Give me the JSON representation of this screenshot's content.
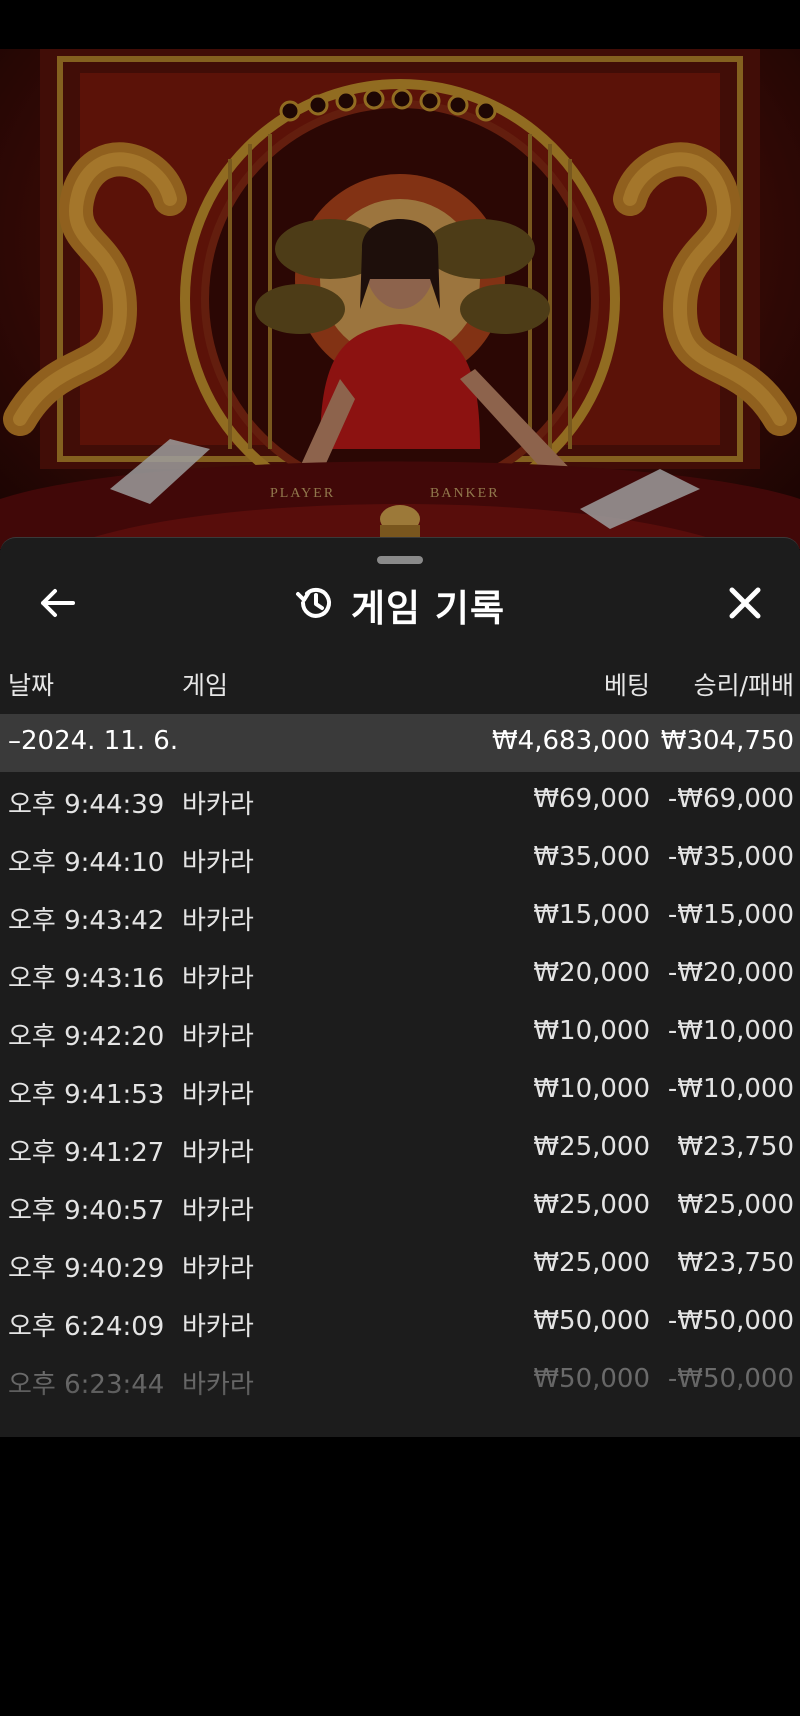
{
  "video": {
    "table_labels": [
      "PLAYER",
      "BANKER"
    ]
  },
  "sheet": {
    "title": "게임 기록",
    "icons": {
      "back": "arrow-left-icon",
      "history": "history-clock-icon",
      "close": "close-icon"
    },
    "columns": {
      "date": "날짜",
      "game": "게임",
      "bet": "베팅",
      "win_loss": "승리/패배"
    },
    "group": {
      "date": "–2024. 11. 6.",
      "total_bet": "₩4,683,000",
      "total_win_loss": "₩304,750"
    },
    "rows": [
      {
        "time": "오후 9:44:39",
        "game": "바카라",
        "bet": "₩69,000",
        "result": "-₩69,000"
      },
      {
        "time": "오후 9:44:10",
        "game": "바카라",
        "bet": "₩35,000",
        "result": "-₩35,000"
      },
      {
        "time": "오후 9:43:42",
        "game": "바카라",
        "bet": "₩15,000",
        "result": "-₩15,000"
      },
      {
        "time": "오후 9:43:16",
        "game": "바카라",
        "bet": "₩20,000",
        "result": "-₩20,000"
      },
      {
        "time": "오후 9:42:20",
        "game": "바카라",
        "bet": "₩10,000",
        "result": "-₩10,000"
      },
      {
        "time": "오후 9:41:53",
        "game": "바카라",
        "bet": "₩10,000",
        "result": "-₩10,000"
      },
      {
        "time": "오후 9:41:27",
        "game": "바카라",
        "bet": "₩25,000",
        "result": "₩23,750"
      },
      {
        "time": "오후 9:40:57",
        "game": "바카라",
        "bet": "₩25,000",
        "result": "₩25,000"
      },
      {
        "time": "오후 9:40:29",
        "game": "바카라",
        "bet": "₩25,000",
        "result": "₩23,750"
      },
      {
        "time": "오후 6:24:09",
        "game": "바카라",
        "bet": "₩50,000",
        "result": "-₩50,000"
      },
      {
        "time": "오후 6:23:44",
        "game": "바카라",
        "bet": "₩50,000",
        "result": "-₩50,000"
      }
    ]
  }
}
